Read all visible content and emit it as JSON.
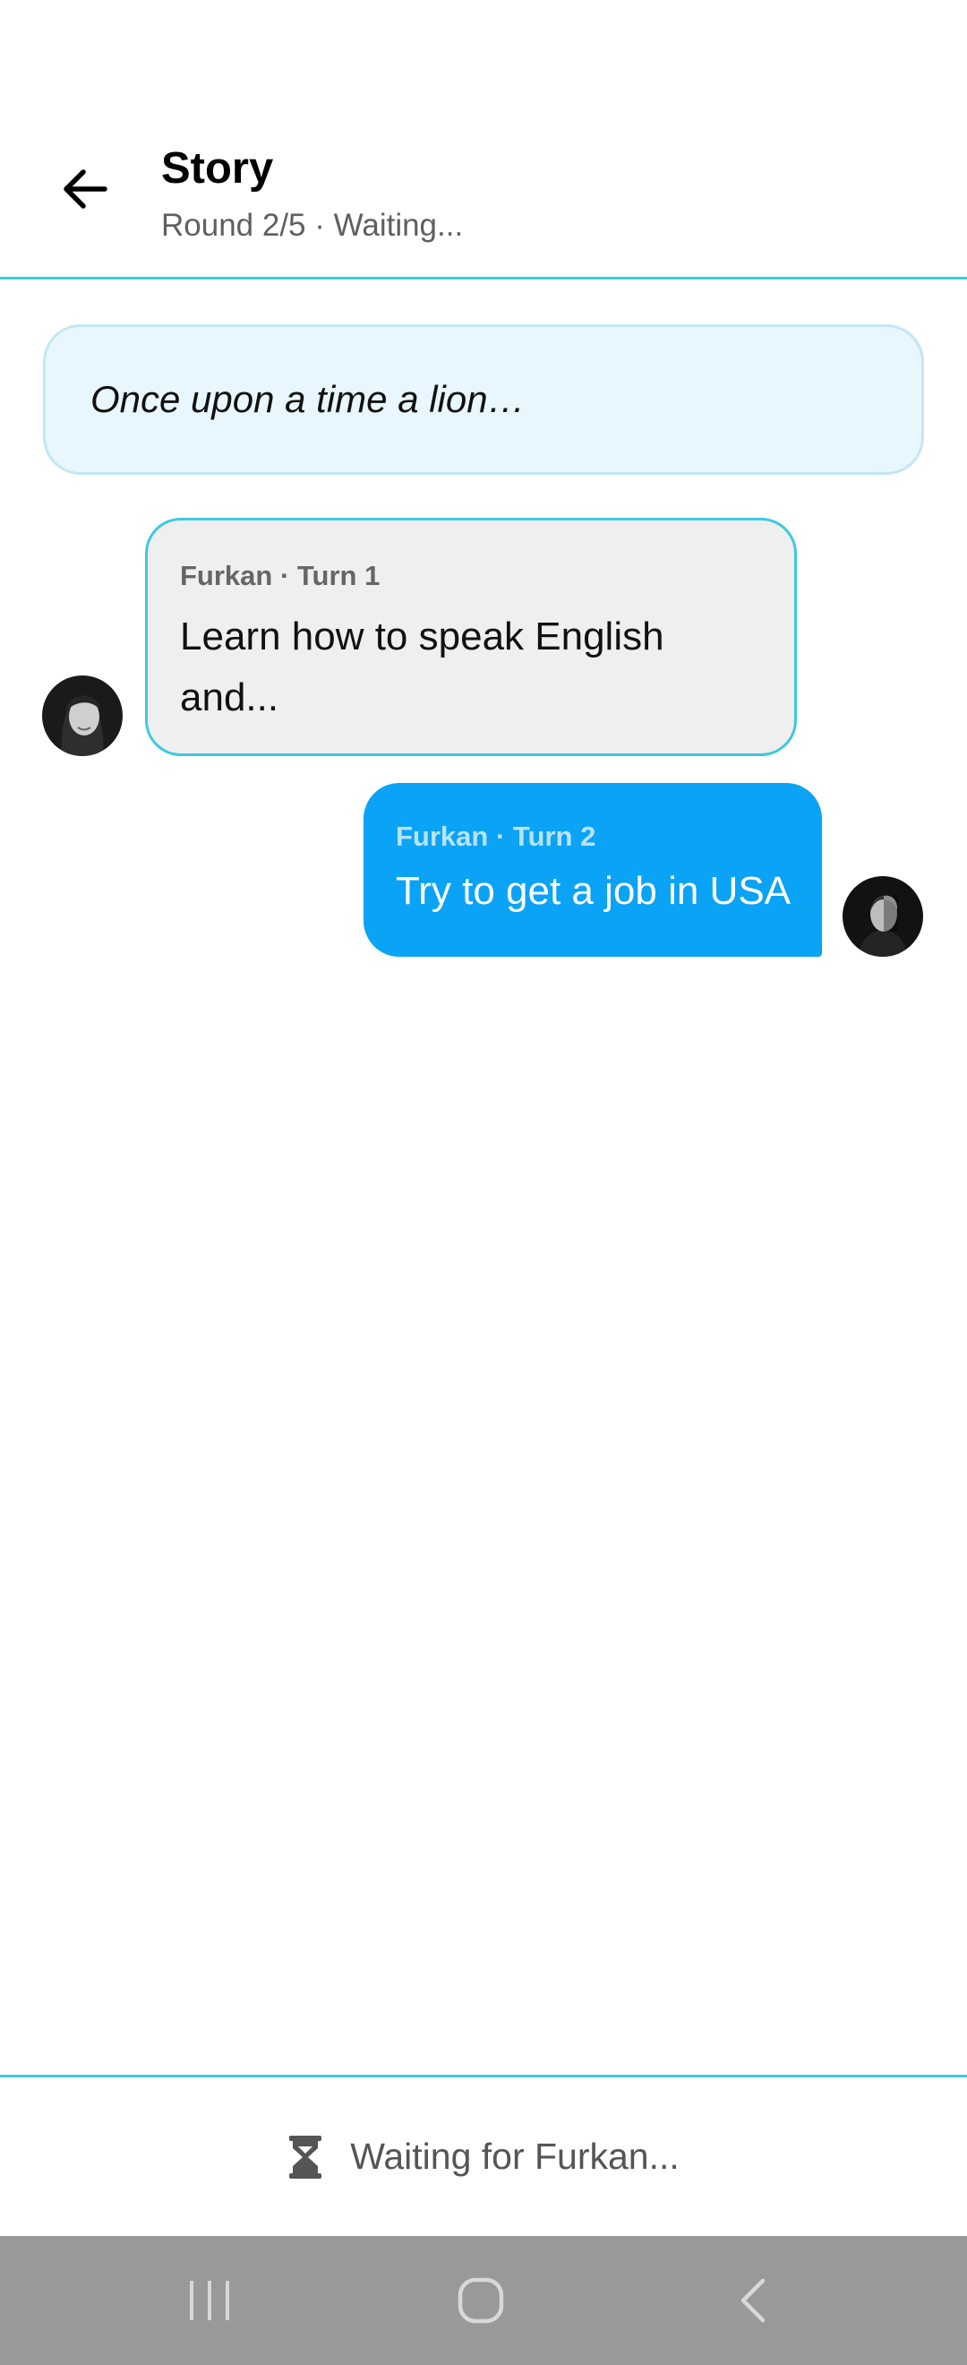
{
  "header": {
    "title": "Story",
    "subtitle": "Round 2/5 · Waiting..."
  },
  "prompt": {
    "text": "Once upon a time a lion…"
  },
  "messages": [
    {
      "meta": "Furkan · Turn 1",
      "text": "Learn how to speak English and...",
      "side": "left"
    },
    {
      "meta": "Furkan · Turn 2",
      "text": "Try to get a job in USA",
      "side": "right"
    }
  ],
  "footer": {
    "status": "Waiting for Furkan...",
    "icon": "hourglass-icon"
  },
  "navbar": {
    "icons": [
      "recent-apps-icon",
      "home-icon",
      "back-nav-icon"
    ]
  },
  "colors": {
    "accent": "#3ec8e0",
    "bubble_blue": "#0aa3f5",
    "bubble_gray": "#efefef",
    "prompt_bg": "#e8f6fd",
    "navbar": "#999999"
  }
}
